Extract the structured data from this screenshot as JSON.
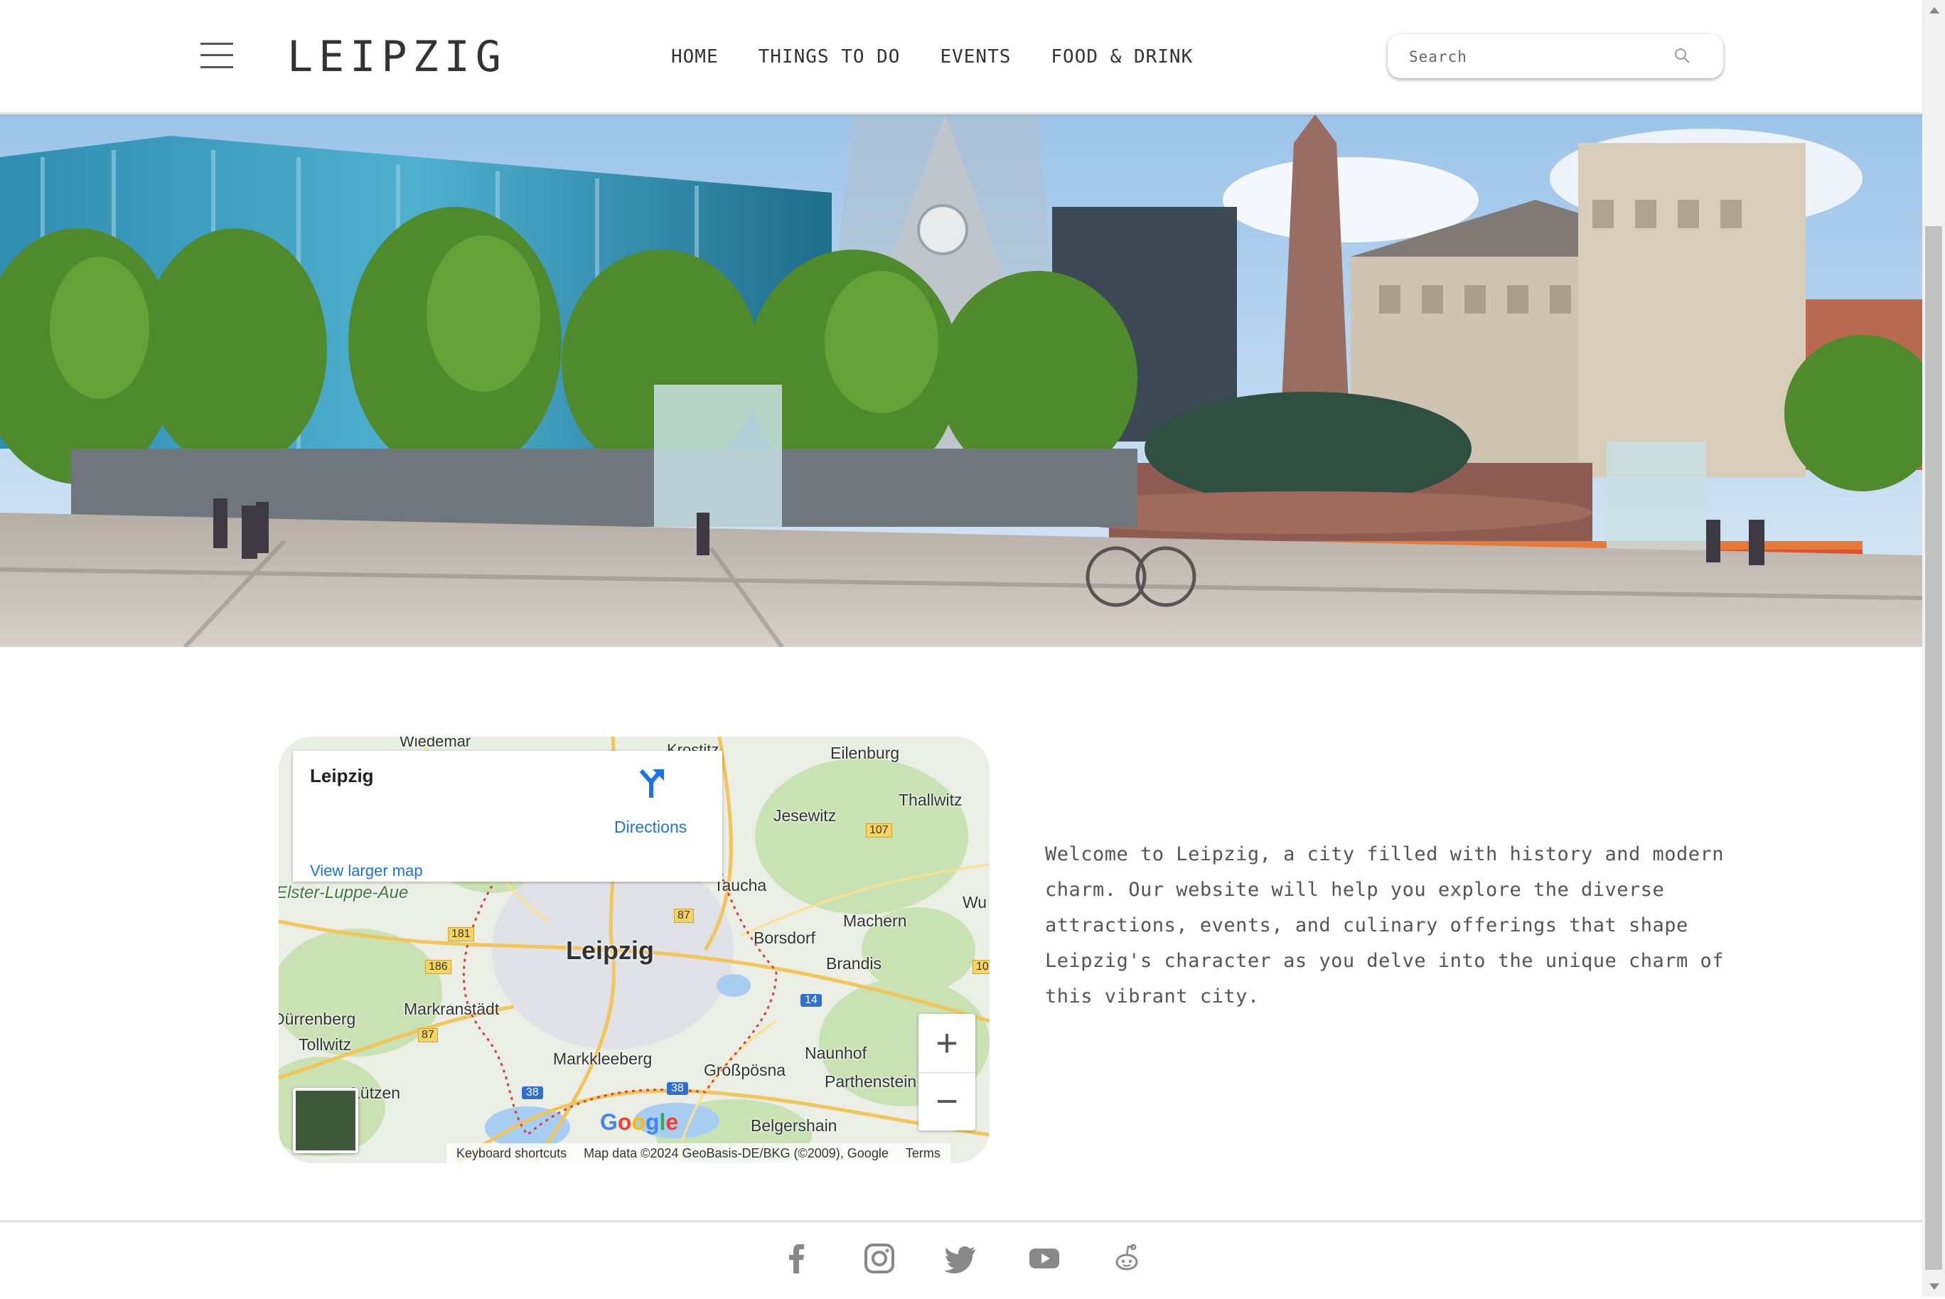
{
  "site": {
    "logo": "LEIPZIG"
  },
  "nav": {
    "items": [
      {
        "label": "HOME"
      },
      {
        "label": "THINGS TO DO"
      },
      {
        "label": "EVENTS"
      },
      {
        "label": "FOOD & DRINK"
      }
    ]
  },
  "search": {
    "placeholder": "Search"
  },
  "hero": {
    "alt": "Augustusplatz Leipzig with Mendebrunnen fountain"
  },
  "map": {
    "card": {
      "place": "Leipzig",
      "directions": "Directions",
      "view_larger": "View larger map"
    },
    "labels": {
      "center": "Leipzig",
      "wiedemar": "Wiedemar",
      "krostitz": "Krostitz",
      "eilenburg": "Eilenburg",
      "thallwitz": "Thallwitz",
      "jesewitz": "Jesewitz",
      "taucha": "Taucha",
      "elster": "Elster-Luppe-Aue",
      "machern": "Machern",
      "borsdorf": "Borsdorf",
      "brandis": "Brandis",
      "markranstaedt": "Markranstädt",
      "duerrenberg": "Dürrenberg",
      "tollwitz": "Tollwitz",
      "markkleeberg": "Markkleeberg",
      "grosspoesna": "Großpösna",
      "naunhof": "Naunhof",
      "parthenstein": "Parthenstein",
      "luetzen": "Lützen",
      "belgershain": "Belgershain",
      "wu": "Wu",
      "r107": "107",
      "r87a": "87",
      "r181": "181",
      "r186": "186",
      "r87b": "87",
      "r14": "14",
      "r38a": "38",
      "r38b": "38",
      "r10": "10"
    },
    "google": "Google",
    "attribution": {
      "shortcuts": "Keyboard shortcuts",
      "data": "Map data ©2024 GeoBasis-DE/BKG (©2009), Google",
      "terms": "Terms"
    },
    "zoom_in": "+",
    "zoom_out": "−"
  },
  "welcome": {
    "text": "Welcome to Leipzig, a city filled with history and modern charm. Our website will help you explore the diverse attractions, events, and culinary offerings that shape Leipzig's character as you delve into the unique charm of this vibrant city."
  },
  "footer": {
    "social": [
      "facebook-icon",
      "instagram-icon",
      "twitter-icon",
      "youtube-icon",
      "reddit-icon"
    ]
  },
  "colors": {
    "link": "#1a73e8",
    "text": "#555555",
    "border": "#e2e2e2"
  }
}
